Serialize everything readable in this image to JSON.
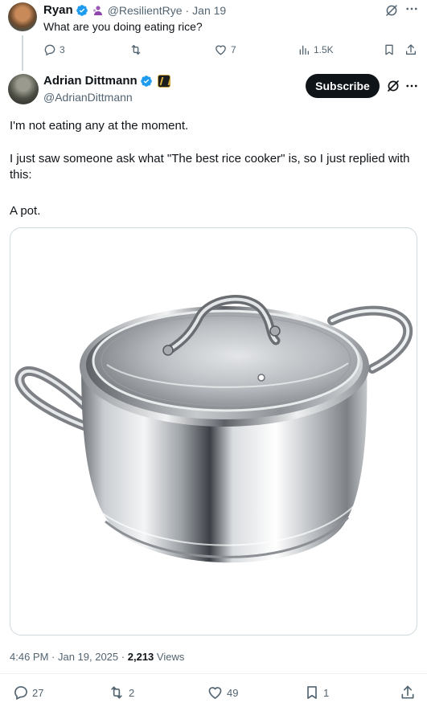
{
  "parent_tweet": {
    "name": "Ryan",
    "handle": "@ResilientRye",
    "separator": "·",
    "date": "Jan 19",
    "text": "What are you doing eating rice?",
    "actions": {
      "replies": "3",
      "reposts": "",
      "likes": "7",
      "views": "1.5K"
    }
  },
  "main_tweet": {
    "name": "Adrian Dittmann",
    "handle": "@AdrianDittmann",
    "subscribe_label": "Subscribe",
    "paragraphs": [
      "I'm not eating any at the moment.",
      "I just saw someone ask what \"The best rice cooker\" is, so I just replied with this:",
      "A pot."
    ],
    "timestamp": "4:46 PM · Jan 19, 2025",
    "meta_separator": "·",
    "views_count": "2,213",
    "views_label": "Views",
    "actions": {
      "replies": "27",
      "reposts": "2",
      "likes": "49",
      "bookmarks": "1"
    }
  },
  "colors": {
    "verified": "#1d9bf0",
    "text": "#0f1419",
    "muted": "#536471",
    "button_bg": "#0f1419"
  },
  "icons": [
    "verified-badge-icon",
    "affiliate-icon",
    "grok-icon",
    "more-icon",
    "reply-icon",
    "repost-icon",
    "like-icon",
    "views-icon",
    "bookmark-icon",
    "share-icon",
    "gold-label-icon"
  ]
}
